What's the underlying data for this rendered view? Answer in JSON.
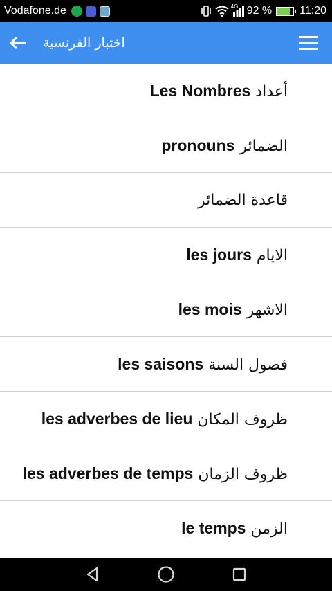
{
  "status_bar": {
    "carrier": "Vodafone.de",
    "network": "4G",
    "battery_percent": "92 %",
    "battery_level": 0.92,
    "time": "11:20",
    "icons": [
      "whatsapp-icon",
      "app-icon",
      "image-icon",
      "vibrate-icon",
      "wifi-icon",
      "signal-icon",
      "battery-icon"
    ]
  },
  "app_bar": {
    "title": "اختبار الفرنسية",
    "color": "#3f8ff0"
  },
  "items": [
    {
      "ar": "أعداد",
      "fr": "Les Nombres"
    },
    {
      "ar": "الضمائر",
      "fr": "pronouns"
    },
    {
      "ar": "قاعدة الضمائر",
      "fr": ""
    },
    {
      "ar": "الايام",
      "fr": "les jours"
    },
    {
      "ar": "الاشهر",
      "fr": "les mois"
    },
    {
      "ar": "فصول السنة",
      "fr": "les saisons"
    },
    {
      "ar": "ظروف المكان",
      "fr": "les adverbes de lieu"
    },
    {
      "ar": "ظروف الزمان",
      "fr": "les adverbes de temps"
    },
    {
      "ar": "الزمن",
      "fr": "le temps"
    }
  ],
  "nav_bar": {
    "icons": [
      "back-triangle-icon",
      "home-circle-icon",
      "recents-square-icon"
    ]
  }
}
